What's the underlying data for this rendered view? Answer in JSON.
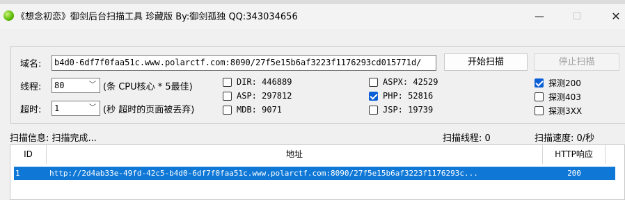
{
  "window": {
    "title": "《想念初恋》御剑后台扫描工具 珍藏版 By:御剑孤独 QQ:343034656",
    "minimize": "—",
    "maximize": "☐",
    "close": "✕"
  },
  "domain": {
    "label": "域名:",
    "value": "b4d0-6df7f0faa51c.www.polarctf.com:8090/27f5e15b6af3223f1176293cd015771d/"
  },
  "buttons": {
    "start": "开始扫描",
    "stop": "停止扫描"
  },
  "threads": {
    "label": "线程:",
    "value": "80",
    "hint": "(条 CPU核心 * 5最佳)"
  },
  "timeout": {
    "label": "超时:",
    "value": "1",
    "hint": "(秒 超时的页面被丢弃)"
  },
  "dicts": [
    {
      "label": "DIR: 446889",
      "checked": false
    },
    {
      "label": "ASP: 297812",
      "checked": false
    },
    {
      "label": "MDB: 9071",
      "checked": false
    },
    {
      "label": "ASPX: 42529",
      "checked": false
    },
    {
      "label": "PHP: 52816",
      "checked": true
    },
    {
      "label": "JSP: 19739",
      "checked": false
    }
  ],
  "probes": [
    {
      "label": "探测200",
      "checked": true
    },
    {
      "label": "探测403",
      "checked": false
    },
    {
      "label": "探测3XX",
      "checked": false
    }
  ],
  "status": {
    "info": "扫描信息: 扫描完成...",
    "threads": "扫描线程: 0",
    "speed": "扫描速度: 0/秒"
  },
  "table": {
    "headers": {
      "id": "ID",
      "address": "地址",
      "http": "HTTP响应"
    },
    "rows": [
      {
        "id": "1",
        "address": "http://2d4ab33e-49fd-42c5-b4d0-6df7f0faa51c.www.polarctf.com:8090/27f5e15b6af3223f1176293c...",
        "http": "200"
      }
    ]
  },
  "colors": {
    "selection": "#0f78d6",
    "checkbox": "#0a5fd6"
  },
  "icons": {
    "app": "green-circle-icon"
  }
}
